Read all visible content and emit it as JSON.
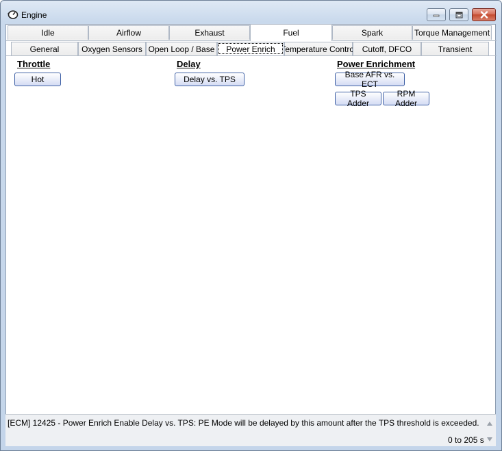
{
  "window": {
    "title": "Engine",
    "app_icon": "engine-gauge-icon",
    "caption_icons": [
      "minimize-icon",
      "maximize-icon",
      "close-icon"
    ]
  },
  "tabs_primary": [
    {
      "label": "Idle",
      "active": false
    },
    {
      "label": "Airflow",
      "active": false
    },
    {
      "label": "Exhaust",
      "active": false
    },
    {
      "label": "Fuel",
      "active": true
    },
    {
      "label": "Spark",
      "active": false
    },
    {
      "label": "Torque Management",
      "active": false
    }
  ],
  "tabs_secondary": [
    {
      "label": "General",
      "active": false
    },
    {
      "label": "Oxygen Sensors",
      "active": false
    },
    {
      "label": "Open Loop / Base",
      "active": false
    },
    {
      "label": "Power Enrich",
      "active": true
    },
    {
      "label": "Temperature Control",
      "active": false
    },
    {
      "label": "Cutoff, DFCO",
      "active": false
    },
    {
      "label": "Transient",
      "active": false
    }
  ],
  "sections": {
    "throttle": {
      "title": "Throttle",
      "buttons": [
        "Hot"
      ]
    },
    "delay": {
      "title": "Delay",
      "buttons": [
        "Delay vs. TPS"
      ]
    },
    "power_enrichment": {
      "title": "Power Enrichment",
      "buttons": [
        "Base AFR vs. ECT",
        "TPS Adder",
        "RPM Adder"
      ]
    }
  },
  "status": {
    "message": "[ECM] 12425 - Power Enrich Enable Delay vs. TPS: PE Mode will be delayed by this amount after the TPS threshold is exceeded.",
    "range": "0 to 205 s"
  },
  "colors": {
    "button_border": "#3c5ea4",
    "close_button": "#c44b2f",
    "tab_border": "#b0b9c6"
  }
}
